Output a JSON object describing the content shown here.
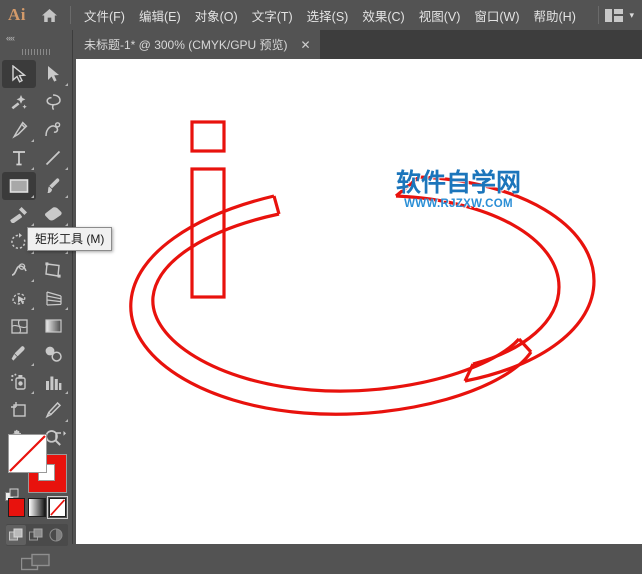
{
  "app": {
    "name": "Adobe Illustrator",
    "logo_text": "Ai",
    "logo_color": "#d39a6a"
  },
  "menubar": {
    "home_icon": "home-icon",
    "items": [
      {
        "label": "文件(F)",
        "name": "menu-file"
      },
      {
        "label": "编辑(E)",
        "name": "menu-edit"
      },
      {
        "label": "对象(O)",
        "name": "menu-object"
      },
      {
        "label": "文字(T)",
        "name": "menu-type"
      },
      {
        "label": "选择(S)",
        "name": "menu-select"
      },
      {
        "label": "效果(C)",
        "name": "menu-effect"
      },
      {
        "label": "视图(V)",
        "name": "menu-view"
      },
      {
        "label": "窗口(W)",
        "name": "menu-window"
      },
      {
        "label": "帮助(H)",
        "name": "menu-help"
      }
    ],
    "workspace_icon": "workspace-layout-icon",
    "workspace_caret": "▾"
  },
  "tabbar": {
    "document_title": "未标题-1* @ 300% (CMYK/GPU 预览)",
    "close_glyph": "✕"
  },
  "toolbar": {
    "collapse_glyph": "««",
    "tooltip": "矩形工具 (M)",
    "tools": [
      {
        "name": "selection-tool",
        "label": "选择工具",
        "active": true,
        "arrow": false
      },
      {
        "name": "direct-selection-tool",
        "label": "直接选择工具",
        "active": false,
        "arrow": true
      },
      {
        "name": "magic-wand-tool",
        "label": "魔棒工具",
        "active": false,
        "arrow": false
      },
      {
        "name": "lasso-tool",
        "label": "套索工具",
        "active": false,
        "arrow": false
      },
      {
        "name": "pen-tool",
        "label": "钢笔工具",
        "active": false,
        "arrow": true
      },
      {
        "name": "curvature-tool",
        "label": "曲率工具",
        "active": false,
        "arrow": false
      },
      {
        "name": "type-tool",
        "label": "文字工具",
        "active": false,
        "arrow": true
      },
      {
        "name": "line-segment-tool",
        "label": "直线段工具",
        "active": false,
        "arrow": true
      },
      {
        "name": "rectangle-tool",
        "label": "矩形工具",
        "active": true,
        "arrow": true
      },
      {
        "name": "paintbrush-tool",
        "label": "画笔工具",
        "active": false,
        "arrow": true
      },
      {
        "name": "shaper-tool",
        "label": "Shaper 工具",
        "active": false,
        "arrow": true
      },
      {
        "name": "eraser-tool",
        "label": "橡皮擦工具",
        "active": false,
        "arrow": true
      },
      {
        "name": "rotate-tool",
        "label": "旋转工具",
        "active": false,
        "arrow": true
      },
      {
        "name": "scale-tool",
        "label": "比例缩放工具",
        "active": false,
        "arrow": true
      },
      {
        "name": "width-tool",
        "label": "宽度工具",
        "active": false,
        "arrow": true
      },
      {
        "name": "free-transform-tool",
        "label": "自由变换工具",
        "active": false,
        "arrow": false
      },
      {
        "name": "shape-builder-tool",
        "label": "形状生成器工具",
        "active": false,
        "arrow": true
      },
      {
        "name": "perspective-grid-tool",
        "label": "透视网格工具",
        "active": false,
        "arrow": true
      },
      {
        "name": "mesh-tool",
        "label": "网格工具",
        "active": false,
        "arrow": false
      },
      {
        "name": "gradient-tool",
        "label": "渐变工具",
        "active": false,
        "arrow": false
      },
      {
        "name": "eyedropper-tool",
        "label": "吸管工具",
        "active": false,
        "arrow": true
      },
      {
        "name": "blend-tool",
        "label": "混合工具",
        "active": false,
        "arrow": false
      },
      {
        "name": "symbol-sprayer-tool",
        "label": "符号喷枪工具",
        "active": false,
        "arrow": true
      },
      {
        "name": "column-graph-tool",
        "label": "柱形图工具",
        "active": false,
        "arrow": true
      },
      {
        "name": "artboard-tool",
        "label": "画板工具",
        "active": false,
        "arrow": false
      },
      {
        "name": "slice-tool",
        "label": "切片工具",
        "active": false,
        "arrow": true
      },
      {
        "name": "hand-tool",
        "label": "抓手工具",
        "active": false,
        "arrow": true
      },
      {
        "name": "zoom-tool",
        "label": "缩放工具",
        "active": false,
        "arrow": false
      }
    ]
  },
  "color_controls": {
    "fill": {
      "name": "fill-swatch",
      "value": "none",
      "color": "#ffffff"
    },
    "stroke": {
      "name": "stroke-swatch",
      "value": "red",
      "color": "#e8120d"
    },
    "swap_icon": "swap-fill-stroke-icon",
    "default_icon": "default-fill-stroke-icon",
    "modes": [
      {
        "name": "color-mode-button",
        "label": "颜色",
        "selected": false
      },
      {
        "name": "gradient-mode-button",
        "label": "渐变",
        "selected": false
      },
      {
        "name": "none-mode-button",
        "label": "无",
        "selected": true
      }
    ],
    "draw_modes": [
      {
        "name": "draw-normal-button",
        "label": "正常绘图",
        "selected": true
      },
      {
        "name": "draw-behind-button",
        "label": "背面绘图",
        "selected": false
      },
      {
        "name": "draw-inside-button",
        "label": "内部绘图",
        "selected": false
      }
    ],
    "screen_mode": {
      "name": "change-screen-mode-button",
      "label": "更改屏幕模式"
    }
  },
  "canvas": {
    "background": "#ffffff",
    "artwork": {
      "name": "ellipse-ring-letter-i-artwork",
      "stroke_color": "#e8120d",
      "zoom": "300%",
      "description": "红色椭圆环与字母 i 轮廓"
    },
    "watermark": {
      "name": "site-watermark",
      "chinese": "软件自学网",
      "url": "WWW.RJZXW.COM",
      "color": "#1b75bb"
    }
  }
}
